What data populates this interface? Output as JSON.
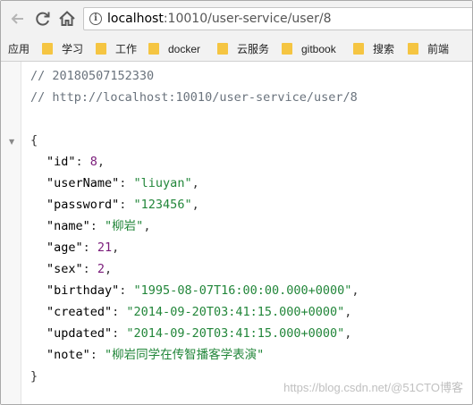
{
  "browser": {
    "url_host": "localhost",
    "url_rest": ":10010/user-service/user/8"
  },
  "bookmarks": {
    "apps_label": "应用",
    "items": [
      {
        "label": "学习"
      },
      {
        "label": "工作"
      },
      {
        "label": "docker"
      },
      {
        "label": "云服务"
      },
      {
        "label": "gitbook"
      },
      {
        "label": "搜索"
      },
      {
        "label": "前端"
      }
    ]
  },
  "viewer": {
    "comment_timestamp": "// 20180507152330",
    "comment_url": "// http://localhost:10010/user-service/user/8",
    "fold_icon": "triangle-down",
    "open_brace": "{",
    "close_brace": "}",
    "fields": [
      {
        "key": "\"id\"",
        "value": "8",
        "type": "num",
        "comma": ","
      },
      {
        "key": "\"userName\"",
        "value": "\"liuyan\"",
        "type": "str",
        "comma": ","
      },
      {
        "key": "\"password\"",
        "value": "\"123456\"",
        "type": "str",
        "comma": ","
      },
      {
        "key": "\"name\"",
        "value": "\"柳岩\"",
        "type": "str",
        "comma": ","
      },
      {
        "key": "\"age\"",
        "value": "21",
        "type": "num",
        "comma": ","
      },
      {
        "key": "\"sex\"",
        "value": "2",
        "type": "num",
        "comma": ","
      },
      {
        "key": "\"birthday\"",
        "value": "\"1995-08-07T16:00:00.000+0000\"",
        "type": "str",
        "comma": ","
      },
      {
        "key": "\"created\"",
        "value": "\"2014-09-20T03:41:15.000+0000\"",
        "type": "str",
        "comma": ","
      },
      {
        "key": "\"updated\"",
        "value": "\"2014-09-20T03:41:15.000+0000\"",
        "type": "str",
        "comma": ","
      },
      {
        "key": "\"note\"",
        "value": "\"柳岩同学在传智播客学表演\"",
        "type": "str",
        "comma": ""
      }
    ]
  },
  "watermark": "https://blog.csdn.net/@51CTO博客",
  "colors": {
    "string": "#22863a",
    "number": "#7a1b7a",
    "comment": "#6a737d",
    "folder": "#f5c542"
  }
}
